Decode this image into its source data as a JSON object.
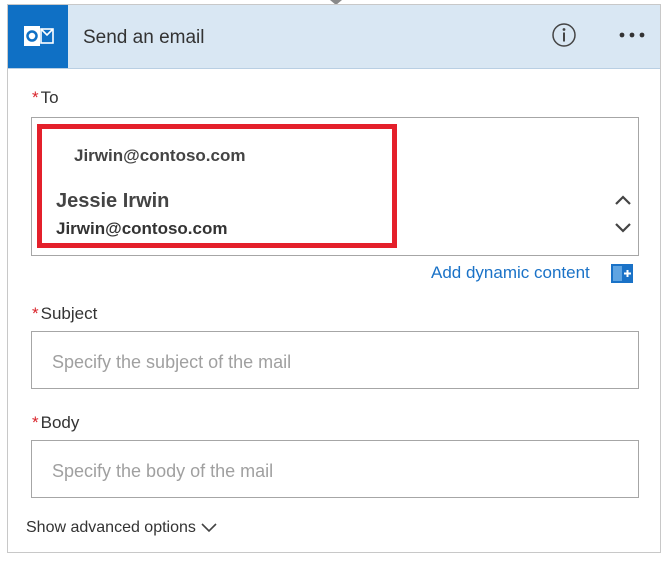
{
  "header": {
    "title": "Send an email",
    "app_icon": "outlook-icon",
    "info_icon": "info-icon",
    "more_icon": "more-options-icon",
    "accent_color": "#0f70c5"
  },
  "to_field": {
    "required_mark": "*",
    "label": "To",
    "entered_value": "Jirwin@contoso.com",
    "suggestion": {
      "name": "Jessie Irwin",
      "email": "Jirwin@contoso.com"
    },
    "highlight_color": "#e4202b"
  },
  "dynamic_content": {
    "link_text": "Add dynamic content",
    "icon": "plus-icon"
  },
  "subject_field": {
    "required_mark": "*",
    "label": "Subject",
    "placeholder": "Specify the subject of the mail"
  },
  "body_field": {
    "required_mark": "*",
    "label": "Body",
    "placeholder": "Specify the body of the mail"
  },
  "advanced": {
    "label": "Show advanced options",
    "icon": "chevron-down-icon"
  }
}
